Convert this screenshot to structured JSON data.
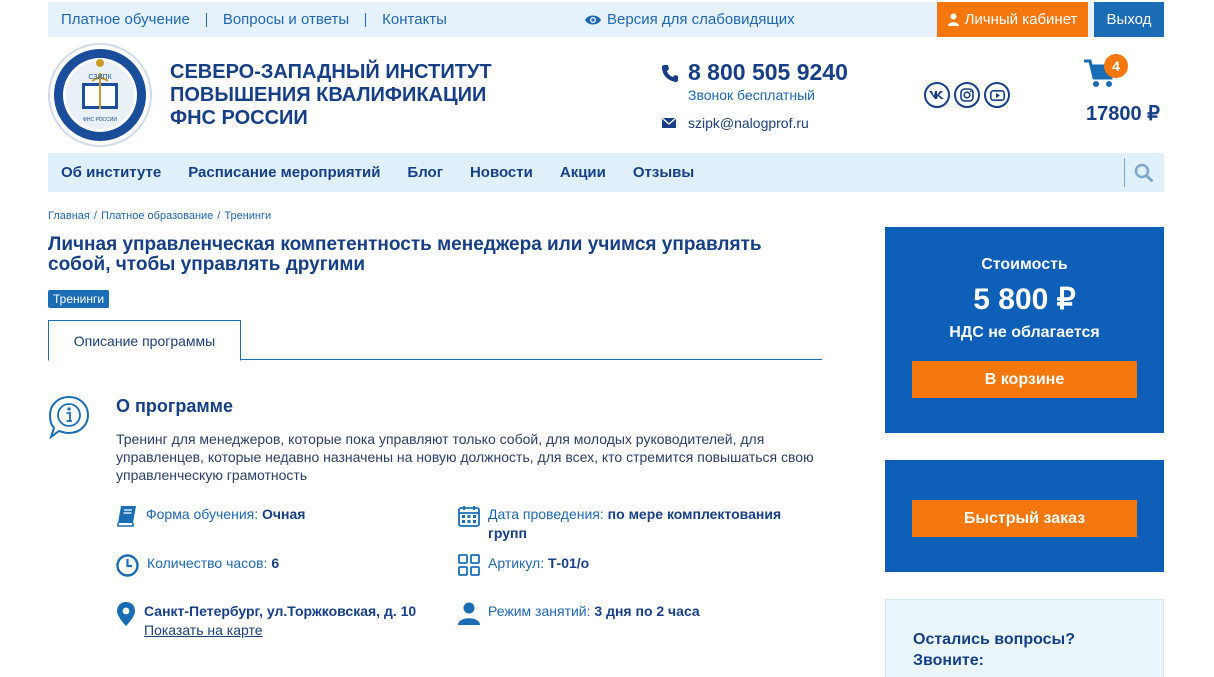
{
  "topbar": {
    "links": [
      "Платное обучение",
      "Вопросы и ответы",
      "Контакты"
    ],
    "vision_label": "Версия для слабовидящих",
    "cabinet_label": "Личный кабинет",
    "logout_label": "Выход"
  },
  "header": {
    "org_name": "СЕВЕРО-ЗАПАДНЫЙ ИНСТИТУТ ПОВЫШЕНИЯ КВАЛИФИКАЦИИ ФНС РОССИИ",
    "logo_text": "СЗИПК",
    "logo_subtext": "ФНС РОССИИ",
    "phone": "8 800 505 9240",
    "phone_note": "Звонок бесплатный",
    "email": "szipk@nalogprof.ru",
    "social": [
      "vk-icon",
      "instagram-icon",
      "youtube-icon"
    ],
    "cart_count": "4",
    "cart_total": "17800 ₽"
  },
  "nav": {
    "items": [
      "Об институте",
      "Расписание мероприятий",
      "Блог",
      "Новости",
      "Акции",
      "Отзывы"
    ]
  },
  "breadcrumbs": [
    "Главная",
    "Платное образование",
    "Тренинги"
  ],
  "page": {
    "title": "Личная управленческая компетентность менеджера или учимся управлять собой, чтобы управлять другими",
    "tag": "Тренинги",
    "tab": "Описание программы",
    "about_title": "О программе",
    "about_text": "Тренинг для менеджеров, которые пока управляют только собой, для молодых руководителей, для управленцев, которые недавно назначены на новую должность, для всех, кто стремится повышаться свою управленческую грамотность"
  },
  "facts": {
    "form_label": "Форма обучения:",
    "form_value": "Очная",
    "date_label": "Дата проведения:",
    "date_value": "по мере комплектования групп",
    "hours_label": "Количество часов:",
    "hours_value": "6",
    "article_label": "Артикул:",
    "article_value": "Т-01/о",
    "address": "Санкт-Петербург, ул.Торжковская, д. 10",
    "map_link": "Показать на карте",
    "mode_label": "Режим занятий:",
    "mode_value": "3 дня по 2 часа"
  },
  "sidebar": {
    "price_caption": "Стоимость",
    "price": "5 800 ₽",
    "vat": "НДС не облагается",
    "cart_button": "В корзине",
    "quick_order_button": "Быстрый заказ",
    "help_text": "Остались вопросы? Звоните:"
  },
  "colors": {
    "primary_blue": "#0d5fb8",
    "dark_blue": "#173f86",
    "orange": "#f7770f",
    "light_bg": "#e6f2fb"
  }
}
